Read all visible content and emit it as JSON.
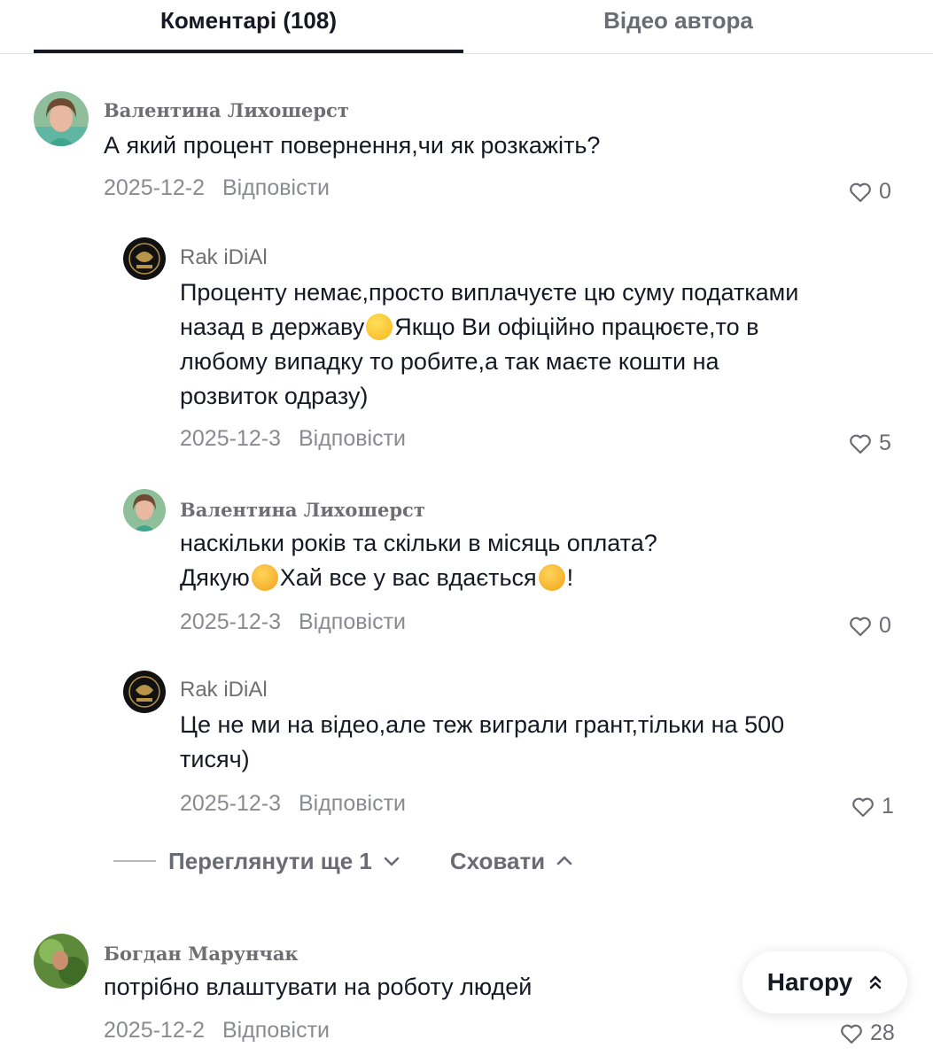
{
  "tabs": {
    "comments": "Коментарі (108)",
    "author_videos": "Відео автора"
  },
  "reply_label": "Відповісти",
  "comments": [
    {
      "author": "Валентина Лихошерст",
      "text": "А який процент повернення,чи як розкажіть?",
      "date": "2025-12-2",
      "likes": "0",
      "replies": [
        {
          "author": "Rak iDiAl",
          "text_before_emoji": "Проценту немає,просто виплачуєте цю суму податками назад в державу",
          "emoji": "wink-emoji",
          "text_after_emoji": "Якщо Ви офіційно працюєте,то в любому випадку то робите,а так маєте кошти на розвиток одразу)",
          "date": "2025-12-3",
          "likes": "5"
        },
        {
          "author": "Валентина Лихошерст",
          "text_line1": "наскільки років та скільки в місяць оплата?",
          "text_part_a": "Дякую",
          "text_part_b": "Хай все у вас вдається",
          "text_part_c": "!",
          "emoji": "smiling-face-with-hearts-emoji",
          "date": "2025-12-3",
          "likes": "0"
        },
        {
          "author": "Rak iDiAl",
          "text": "Це не ми на відео,але теж виграли грант,тільки на 500 тисяч)",
          "date": "2025-12-3",
          "likes": "1"
        }
      ],
      "view_more": "Переглянути ще 1",
      "hide": "Сховати"
    },
    {
      "author": "Богдан Марунчак",
      "text": "потрібно влаштувати на роботу людей",
      "date": "2025-12-2",
      "likes": "28"
    }
  ],
  "back_to_top": "Нагору",
  "icons": {
    "like": "heart-outline-icon",
    "expand": "chevron-down-icon",
    "collapse": "chevron-up-icon",
    "top": "double-chevron-up-icon"
  }
}
